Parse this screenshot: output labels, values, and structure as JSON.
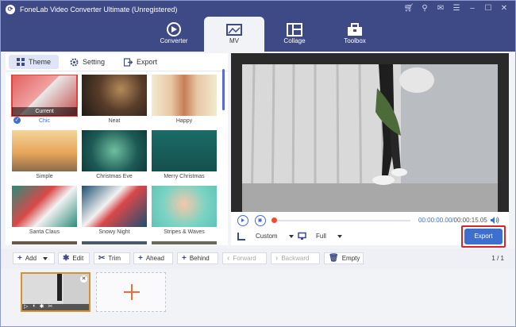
{
  "app": {
    "title": "FoneLab Video Converter Ultimate (Unregistered)"
  },
  "nav": {
    "tabs": [
      {
        "label": "Converter"
      },
      {
        "label": "MV"
      },
      {
        "label": "Collage"
      },
      {
        "label": "Toolbox"
      }
    ],
    "active": "MV"
  },
  "subtabs": [
    {
      "label": "Theme"
    },
    {
      "label": "Setting"
    },
    {
      "label": "Export"
    }
  ],
  "themes": [
    {
      "label": "Chic",
      "badge": "Current",
      "selected": true
    },
    {
      "label": "Neat"
    },
    {
      "label": "Happy"
    },
    {
      "label": "Simple"
    },
    {
      "label": "Christmas Eve"
    },
    {
      "label": "Merry Christmas"
    },
    {
      "label": "Santa Claus"
    },
    {
      "label": "Snowy Night"
    },
    {
      "label": "Stripes & Waves"
    }
  ],
  "player": {
    "current_time": "00:00:00.00",
    "separator": "/",
    "total_time": "00:00:15.05"
  },
  "options": {
    "aspect": "Custom",
    "fit": "Full"
  },
  "export": {
    "label": "Export"
  },
  "toolbar": {
    "add": "Add",
    "edit": "Edit",
    "trim": "Trim",
    "ahead": "Ahead",
    "behind": "Behind",
    "forward": "Forward",
    "backward": "Backward",
    "empty": "Empty"
  },
  "timeline": {
    "page_count": "1 / 1"
  },
  "colors": {
    "nav_bg": "#3d4a86",
    "accent": "#3d6fd1",
    "highlight": "#d8232a"
  }
}
